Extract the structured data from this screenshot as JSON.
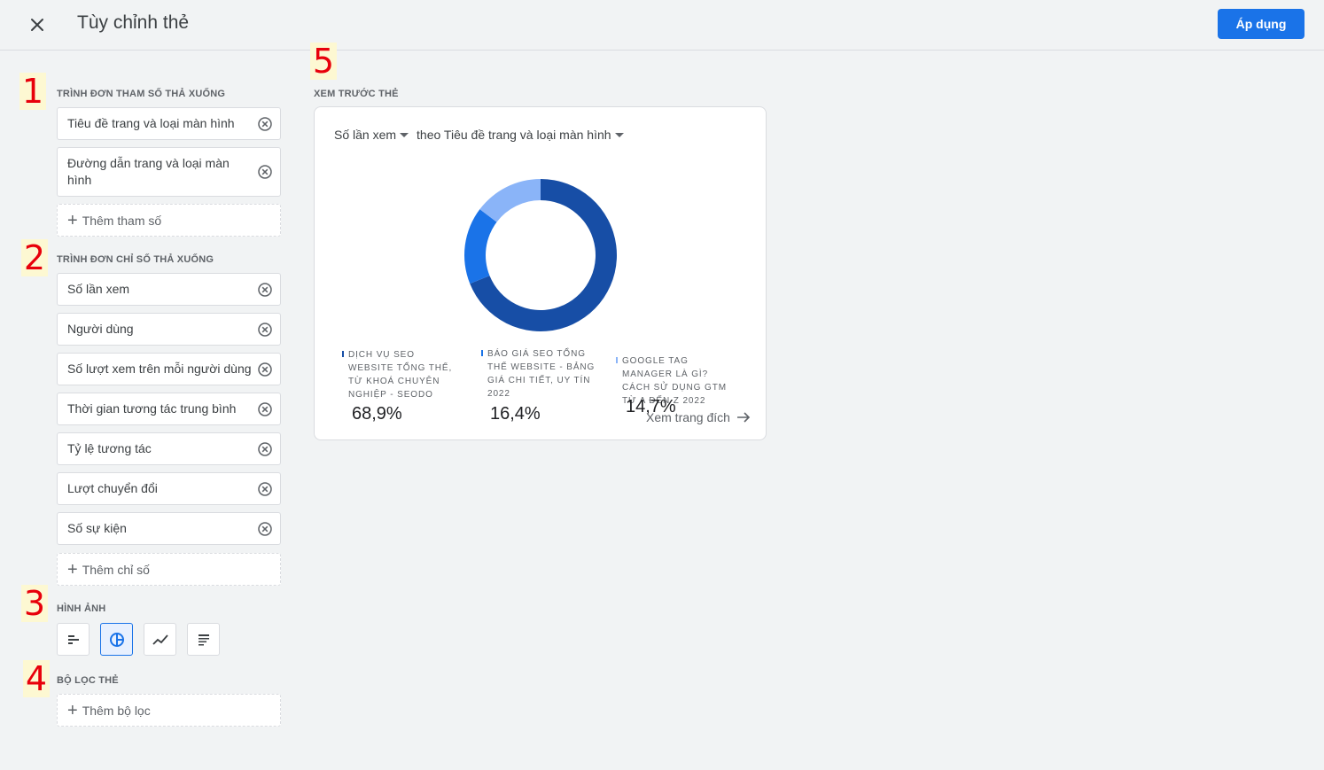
{
  "header": {
    "title": "Tùy chỉnh thẻ",
    "apply_label": "Áp dụng"
  },
  "markers": [
    "1",
    "2",
    "3",
    "4",
    "5"
  ],
  "dimensions": {
    "label": "TRÌNH ĐƠN THAM SỐ THẢ XUỐNG",
    "items": [
      "Tiêu đề trang và loại màn hình",
      "Đường dẫn trang và loại màn hình"
    ],
    "add_label": "Thêm tham số"
  },
  "metrics": {
    "label": "TRÌNH ĐƠN CHỈ SỐ THẢ XUỐNG",
    "items": [
      "Số lần xem",
      "Người dùng",
      "Số lượt xem trên mỗi người dùng",
      "Thời gian tương tác trung bình",
      "Tỷ lệ tương tác",
      "Lượt chuyển đổi",
      "Số sự kiện"
    ],
    "add_label": "Thêm chỉ số"
  },
  "visualization": {
    "label": "HÌNH ẢNH",
    "options": [
      {
        "icon": "bar-chart-icon",
        "selected": false
      },
      {
        "icon": "donut-chart-icon",
        "selected": true
      },
      {
        "icon": "line-chart-icon",
        "selected": false
      },
      {
        "icon": "table-icon",
        "selected": false
      }
    ]
  },
  "filters": {
    "label": "BỘ LỌC THẺ",
    "add_label": "Thêm bộ lọc"
  },
  "preview": {
    "label": "XEM TRƯỚC THẺ",
    "metric_selector": "Số lần xem",
    "dimension_selector": "theo Tiêu đề trang và loại màn hình",
    "view_link": "Xem trang đích",
    "legend": [
      {
        "label": "DỊCH VỤ SEO WEBSITE TỔNG THỂ, TỪ KHOÁ CHUYÊN NGHIỆP - SEODO",
        "value": "68,9%",
        "color": "#174ea6"
      },
      {
        "label": "BÁO GIÁ SEO TỔNG THỂ WEBSITE - BẢNG GIÁ CHI TIẾT, UY TÍN 2022",
        "value": "16,4%",
        "color": "#1a73e8"
      },
      {
        "label": "GOOGLE TAG MANAGER LÀ GÌ? CÁCH SỬ DỤNG GTM TỪ A ĐẾN Z 2022",
        "value": "14,7%",
        "color": "#8ab4f8"
      }
    ]
  },
  "chart_data": {
    "type": "pie",
    "categories": [
      "DỊCH VỤ SEO WEBSITE TỔNG THỂ, TỪ KHOÁ CHUYÊN NGHIỆP - SEODO",
      "BÁO GIÁ SEO TỔNG THỂ WEBSITE - BẢNG GIÁ CHI TIẾT, UY TÍN 2022",
      "GOOGLE TAG MANAGER LÀ GÌ? CÁCH SỬ DỤNG GTM TỪ A ĐẾN Z 2022"
    ],
    "values": [
      68.9,
      16.4,
      14.7
    ],
    "colors": [
      "#174ea6",
      "#1a73e8",
      "#8ab4f8"
    ],
    "donut": true,
    "legend": "bottom"
  }
}
